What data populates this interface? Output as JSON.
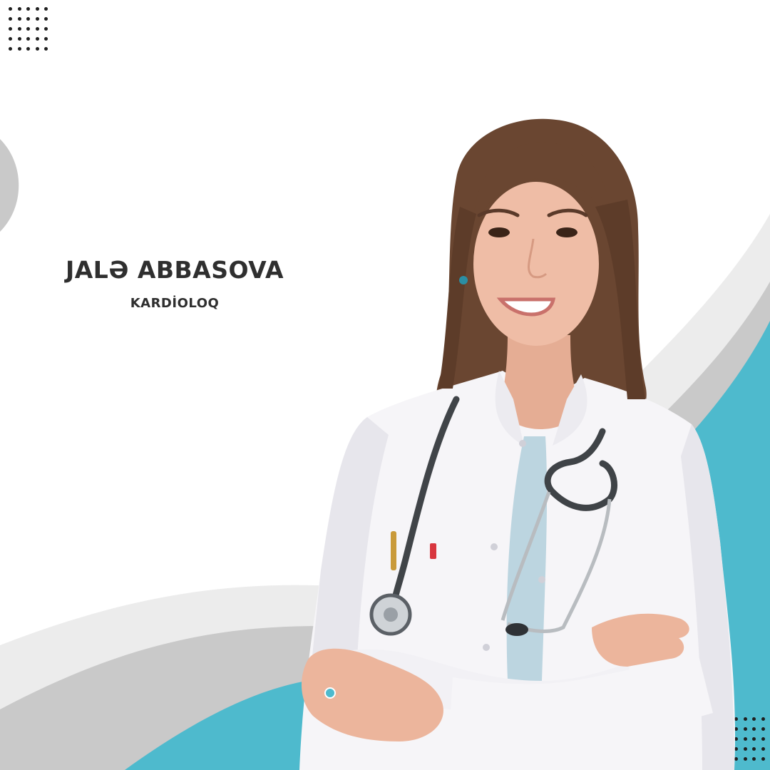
{
  "doctor": {
    "name": "JALƏ ABBASOVA",
    "title": "KARDİOLOQ"
  },
  "colors": {
    "background": "#ffffff",
    "accent_teal": "#4ebacd",
    "accent_gray": "#c9c9c9",
    "wave_light": "#ececec",
    "text": "#2f2f2f",
    "dots": "#1f1f1f"
  }
}
